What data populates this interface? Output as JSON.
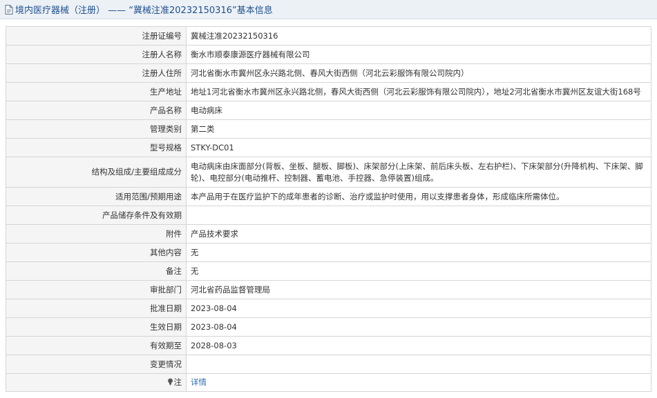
{
  "header": {
    "prefix": "境内医疗器械（注册）",
    "dash": " —— ",
    "title": "“冀械注准20232150316”基本信息"
  },
  "rows": [
    {
      "label": "注册证编号",
      "value": "冀械注准20232150316"
    },
    {
      "label": "注册人名称",
      "value": "衡水市顺泰康源医疗器械有限公司"
    },
    {
      "label": "注册人住所",
      "value": "河北省衡水市冀州区永兴路北侧、春风大街西侧（河北云彩服饰有限公司院内）"
    },
    {
      "label": "生产地址",
      "value": "地址1河北省衡水市冀州区永兴路北侧，春风大街西侧（河北云彩服饰有限公司院内），地址2河北省衡水市冀州区友谊大街168号"
    },
    {
      "label": "产品名称",
      "value": "电动病床"
    },
    {
      "label": "管理类别",
      "value": "第二类"
    },
    {
      "label": "型号规格",
      "value": "STKY-DC01"
    },
    {
      "label": "结构及组成/主要组成成分",
      "value": "电动病床由床面部分(背板、坐板、腿板、脚板)、床架部分(上床架、前后床头板、左右护栏)、下床架部分(升降机构、下床架、脚轮)、电控部分(电动推杆、控制器、蓄电池、手控器、急停装置)组成。"
    },
    {
      "label": "适用范围/预期用途",
      "value": "本产品用于在医疗监护下的成年患者的诊断、治疗或监护时使用，用以支撑患者身体，形成临床所需体位。"
    },
    {
      "label": "产品储存条件及有效期",
      "value": ""
    },
    {
      "label": "附件",
      "value": "产品技术要求"
    },
    {
      "label": "其他内容",
      "value": "无"
    },
    {
      "label": "备注",
      "value": "无"
    },
    {
      "label": "审批部门",
      "value": "河北省药品监督管理局"
    },
    {
      "label": "批准日期",
      "value": "2023-08-04"
    },
    {
      "label": "生效日期",
      "value": "2023-08-04"
    },
    {
      "label": "有效期至",
      "value": "2028-08-03"
    },
    {
      "label": "变更情况",
      "value": ""
    }
  ],
  "note": {
    "label": "注",
    "link": "详情"
  },
  "colors": {
    "header_bg": "#ecf1f6",
    "header_text": "#1f4f8f",
    "label_bg": "#f5f5f5",
    "border": "#d5d5d5",
    "link": "#2a6db3"
  },
  "icons": {
    "header": "document-icon",
    "note": "lightbulb-icon"
  }
}
